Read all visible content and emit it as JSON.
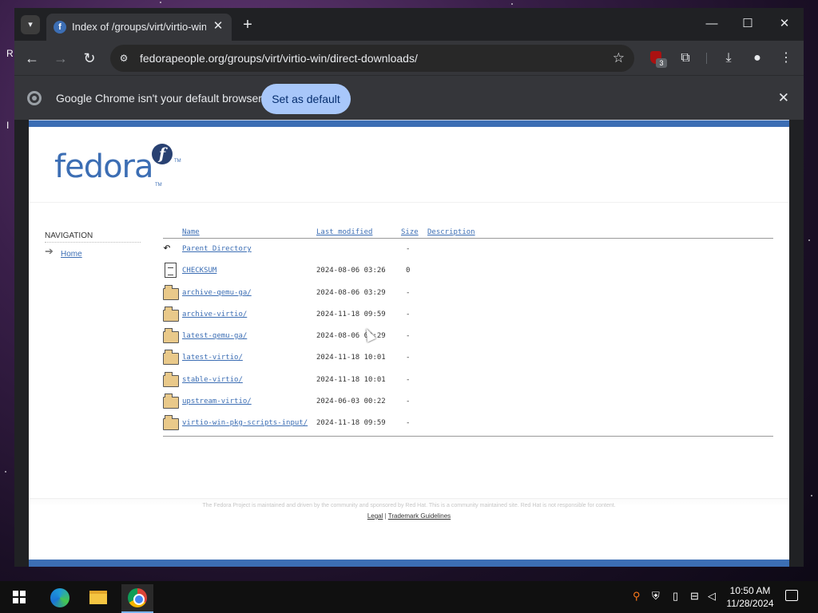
{
  "browser": {
    "tab_title": "Index of /groups/virt/virtio-win/direct-downloads/",
    "url": "fedorapeople.org/groups/virt/virtio-win/direct-downloads/",
    "extension_badge": "3",
    "infobar": {
      "message": "Google Chrome isn't your default browser",
      "button": "Set as default"
    }
  },
  "page": {
    "logo_text": "fedora",
    "nav": {
      "title": "NAVIGATION",
      "home": "Home"
    },
    "columns": [
      "Name",
      "Last modified",
      "Size",
      "Description"
    ],
    "rows": [
      {
        "icon": "back",
        "name": "Parent Directory",
        "date": "",
        "size": "-"
      },
      {
        "icon": "file",
        "name": "CHECKSUM",
        "date": "2024-08-06 03:26",
        "size": "0"
      },
      {
        "icon": "folder",
        "name": "archive-qemu-ga/",
        "date": "2024-08-06 03:29",
        "size": "-"
      },
      {
        "icon": "folder",
        "name": "archive-virtio/",
        "date": "2024-11-18 09:59",
        "size": "-"
      },
      {
        "icon": "folder",
        "name": "latest-qemu-ga/",
        "date": "2024-08-06 03:29",
        "size": "-"
      },
      {
        "icon": "folder",
        "name": "latest-virtio/",
        "date": "2024-11-18 10:01",
        "size": "-"
      },
      {
        "icon": "folder",
        "name": "stable-virtio/",
        "date": "2024-11-18 10:01",
        "size": "-"
      },
      {
        "icon": "folder",
        "name": "upstream-virtio/",
        "date": "2024-06-03 00:22",
        "size": "-"
      },
      {
        "icon": "folder",
        "name": "virtio-win-pkg-scripts-input/",
        "date": "2024-11-18 09:59",
        "size": "-"
      }
    ],
    "footer": {
      "text": "The Fedora Project is maintained and driven by the community and sponsored by Red Hat. This is a community maintained site. Red Hat is not responsible for content.",
      "links": [
        "Legal",
        "Trademark Guidelines"
      ],
      "separator": "|"
    }
  },
  "taskbar": {
    "time": "10:50 AM",
    "date": "11/28/2024"
  },
  "colors": {
    "fedora_blue": "#3c6eb4",
    "chrome_dark": "#202124",
    "set_default_button": "#a8c7fa"
  }
}
